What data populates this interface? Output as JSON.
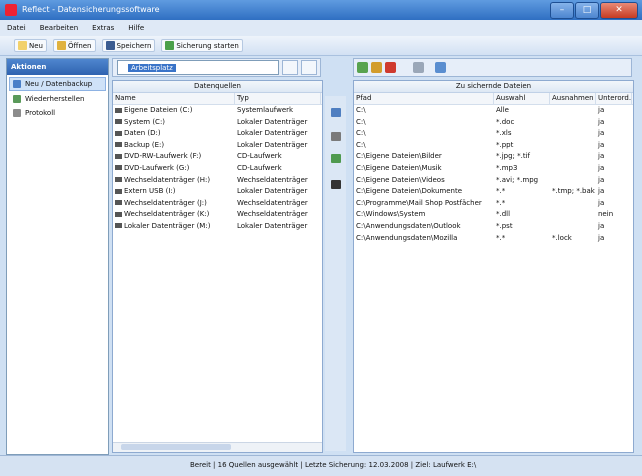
{
  "window": {
    "title": "Reflect - Datensicherungssoftware",
    "buttons": {
      "minimize": "–",
      "maximize": "□",
      "close": "✕"
    }
  },
  "menu": [
    "Datei",
    "Bearbeiten",
    "Extras",
    "Hilfe"
  ],
  "toolbar": {
    "new": "Neu",
    "open": "Öffnen",
    "save": "Speichern",
    "schedule": "Sicherung starten"
  },
  "sidebar": {
    "title": "Aktionen",
    "items": [
      "Neu / Datenbackup",
      "Wiederherstellen",
      "Protokoll"
    ]
  },
  "left_toolbar": {
    "drive_value": "Arbeitsplatz"
  },
  "left_panel": {
    "title": "Datenquellen",
    "columns": [
      "Name",
      "Typ"
    ],
    "rows": [
      {
        "name": "Eigene Dateien (C:)",
        "type": "Systemlaufwerk"
      },
      {
        "name": "System (C:)",
        "type": "Lokaler Datenträger"
      },
      {
        "name": "Daten (D:)",
        "type": "Lokaler Datenträger"
      },
      {
        "name": "Backup (E:)",
        "type": "Lokaler Datenträger"
      },
      {
        "name": "DVD-RW-Laufwerk (F:)",
        "type": "CD-Laufwerk"
      },
      {
        "name": "DVD-Laufwerk (G:)",
        "type": "CD-Laufwerk"
      },
      {
        "name": "Wechseldatenträger (H:)",
        "type": "Wechseldatenträger"
      },
      {
        "name": "Extern USB (I:)",
        "type": "Lokaler Datenträger"
      },
      {
        "name": "Wechseldatenträger (J:)",
        "type": "Wechseldatenträger"
      },
      {
        "name": "Wechseldatenträger (K:)",
        "type": "Wechseldatenträger"
      },
      {
        "name": "Lokaler Datenträger (M:)",
        "type": "Lokaler Datenträger"
      }
    ]
  },
  "right_panel": {
    "title": "Zu sichernde Dateien",
    "columns": [
      "Pfad",
      "Auswahl",
      "Ausnahmen",
      "Unterord."
    ],
    "rows": [
      {
        "path": "C:\\",
        "sel": "Alle",
        "exc": "",
        "sub": "ja"
      },
      {
        "path": "C:\\",
        "sel": "*.doc",
        "exc": "",
        "sub": "ja"
      },
      {
        "path": "C:\\",
        "sel": "*.xls",
        "exc": "",
        "sub": "ja"
      },
      {
        "path": "C:\\",
        "sel": "*.ppt",
        "exc": "",
        "sub": "ja"
      },
      {
        "path": "C:\\Eigene Dateien\\Bilder",
        "sel": "*.jpg; *.tif",
        "exc": "",
        "sub": "ja"
      },
      {
        "path": "C:\\Eigene Dateien\\Musik",
        "sel": "*.mp3",
        "exc": "",
        "sub": "ja"
      },
      {
        "path": "C:\\Eigene Dateien\\Videos",
        "sel": "*.avi; *.mpg",
        "exc": "",
        "sub": "ja"
      },
      {
        "path": "C:\\Eigene Dateien\\Dokumente",
        "sel": "*.*",
        "exc": "*.tmp; *.bak",
        "sub": "ja"
      },
      {
        "path": "C:\\Programme\\Mail Shop Postfächer",
        "sel": "*.*",
        "exc": "",
        "sub": "ja"
      },
      {
        "path": "C:\\Windows\\System",
        "sel": "*.dll",
        "exc": "",
        "sub": "nein"
      },
      {
        "path": "C:\\Anwendungsdaten\\Outlook",
        "sel": "*.pst",
        "exc": "",
        "sub": "ja"
      },
      {
        "path": "C:\\Anwendungsdaten\\Mozilla",
        "sel": "*.*",
        "exc": "*.lock",
        "sub": "ja"
      }
    ]
  },
  "status": "Bereit  |  16 Quellen ausgewählt  |  Letzte Sicherung: 12.03.2008  |  Ziel: Laufwerk E:\\"
}
